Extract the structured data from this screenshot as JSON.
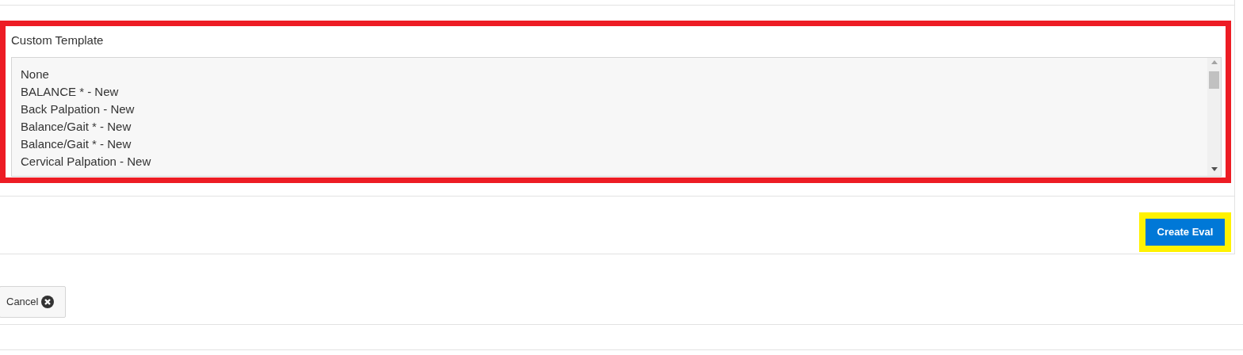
{
  "custom_template": {
    "label": "Custom Template",
    "options": [
      {
        "label": "None"
      },
      {
        "label": "BALANCE * - New"
      },
      {
        "label": "Back Palpation - New"
      },
      {
        "label": "Balance/Gait * - New"
      },
      {
        "label": "Balance/Gait * - New"
      },
      {
        "label": "Cervical Palpation - New"
      }
    ]
  },
  "create_button": "Create Eval",
  "cancel_button": "Cancel"
}
